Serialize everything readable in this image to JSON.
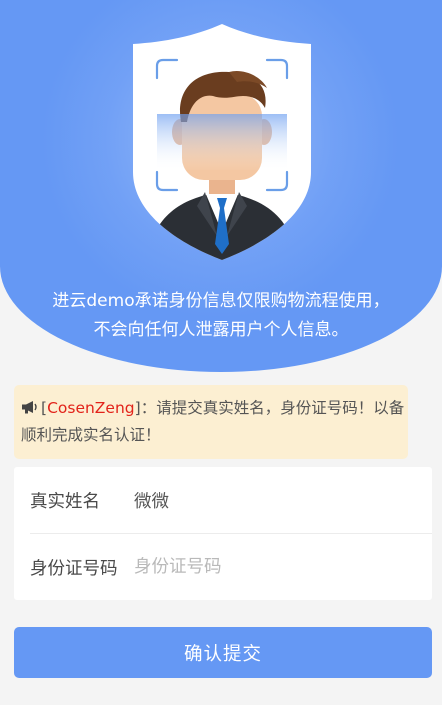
{
  "hero": {
    "line1": "进云demo承诺身份信息仅限购物流程使用，",
    "line2": "不会向任何人泄露用户个人信息。",
    "illustration_icon": "shield-face-id-icon"
  },
  "notice": {
    "icon": "megaphone-icon",
    "bracket_open": "[",
    "username": "CosenZeng",
    "bracket_close": "]",
    "message": "：请提交真实姓名，身份证号码！以备顺利完成实名认证！"
  },
  "form": {
    "name": {
      "label": "真实姓名",
      "value": "微微",
      "placeholder": ""
    },
    "id_number": {
      "label": "身份证号码",
      "value": "",
      "placeholder": "身份证号码"
    }
  },
  "submit": {
    "label": "确认提交"
  },
  "colors": {
    "primary": "#6598f4",
    "notice_bg": "#fcefd2",
    "username": "#e2231a",
    "page_bg": "#f4f4f4"
  }
}
